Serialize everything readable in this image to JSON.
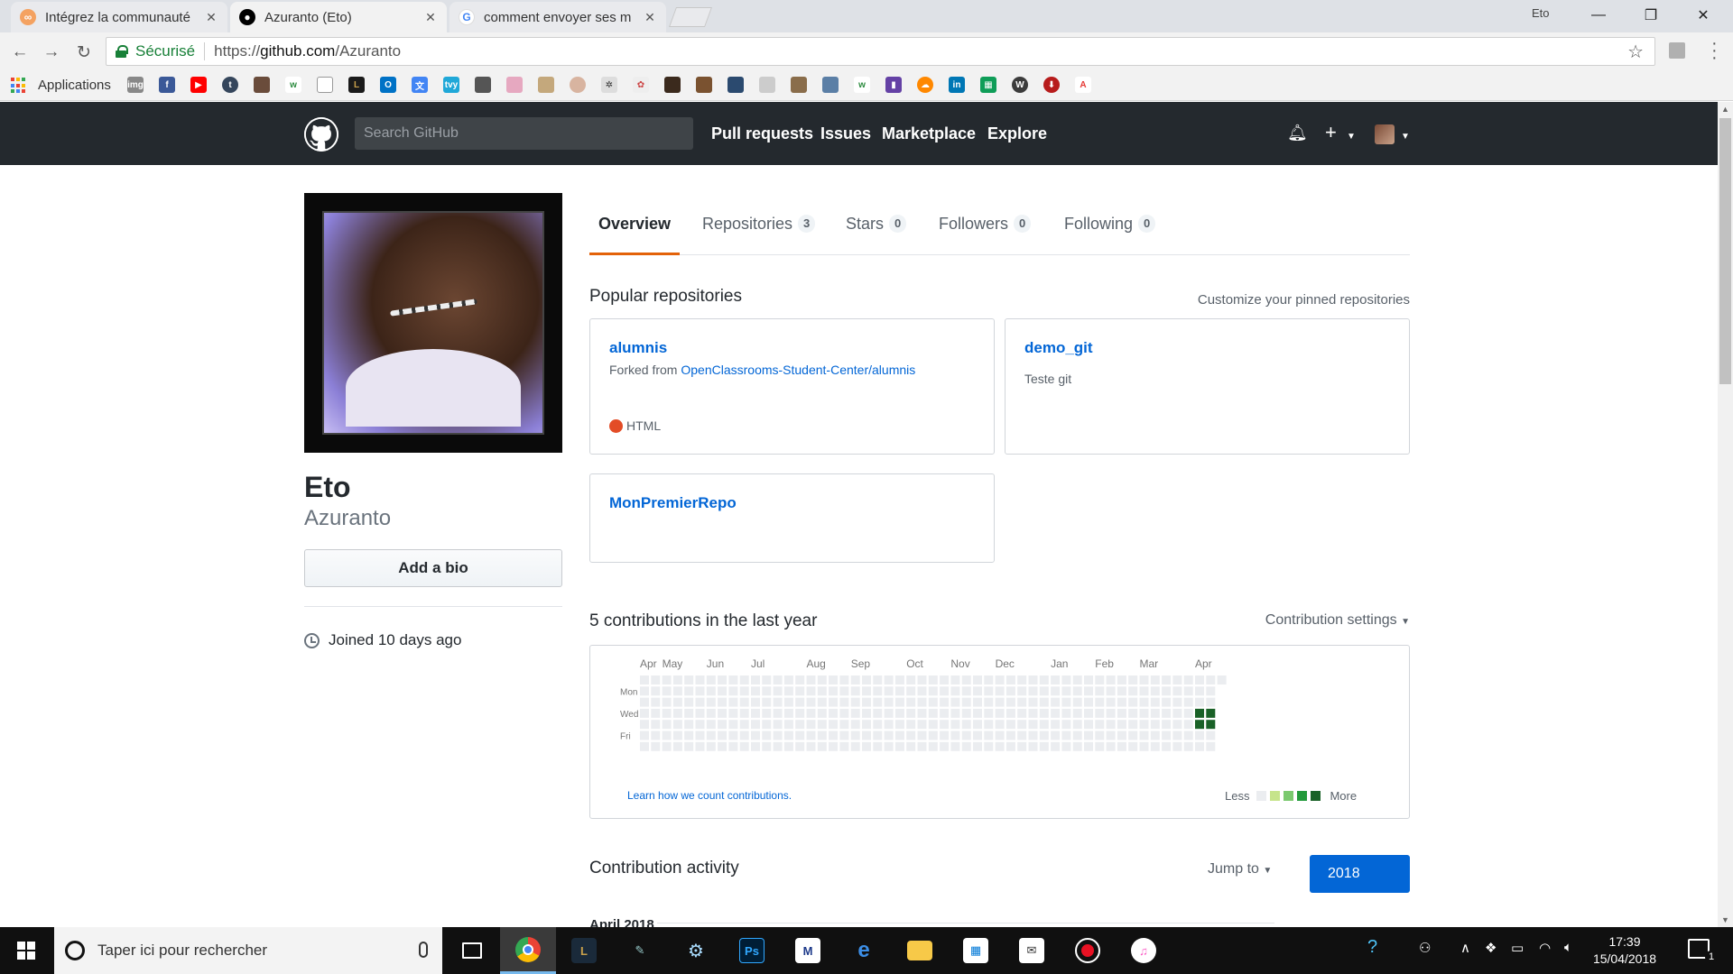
{
  "browser": {
    "tabs": [
      {
        "title": "Intégrez la communauté",
        "favicon": "openclassrooms-icon",
        "active": false
      },
      {
        "title": "Azuranto (Eto)",
        "favicon": "github-icon",
        "active": true
      },
      {
        "title": "comment envoyer ses m",
        "favicon": "google-icon",
        "active": false
      }
    ],
    "user_badge": "Eto",
    "window_buttons": {
      "minimize": "—",
      "restore": "❐",
      "close": "✕"
    },
    "security_label": "Sécurisé",
    "url_scheme": "https://",
    "url_host": "github.com",
    "url_path": "/Azuranto",
    "bookmarks_apps_label": "Applications"
  },
  "github": {
    "search_placeholder": "Search GitHub",
    "nav": [
      "Pull requests",
      "Issues",
      "Marketplace",
      "Explore"
    ],
    "new_label": "+"
  },
  "profile": {
    "full_name": "Eto",
    "login": "Azuranto",
    "add_bio_label": "Add a bio",
    "joined": "Joined 10 days ago"
  },
  "profile_tabs": [
    {
      "label": "Overview",
      "count": null
    },
    {
      "label": "Repositories",
      "count": "3"
    },
    {
      "label": "Stars",
      "count": "0"
    },
    {
      "label": "Followers",
      "count": "0"
    },
    {
      "label": "Following",
      "count": "0"
    }
  ],
  "popular": {
    "title": "Popular repositories",
    "customize": "Customize your pinned repositories",
    "repos": [
      {
        "name": "alumnis",
        "forked_prefix": "Forked from",
        "forked_from": "OpenClassrooms-Student-Center/alumnis",
        "language": "HTML",
        "language_color": "#e34c26"
      },
      {
        "name": "demo_git",
        "description": "Teste git"
      },
      {
        "name": "MonPremierRepo"
      }
    ]
  },
  "contributions": {
    "title": "5 contributions in the last year",
    "settings_label": "Contribution settings",
    "months": [
      "Apr",
      "May",
      "Jun",
      "Jul",
      "Aug",
      "Sep",
      "Oct",
      "Nov",
      "Dec",
      "Jan",
      "Feb",
      "Mar",
      "Apr"
    ],
    "weekdays": [
      "Mon",
      "Wed",
      "Fri"
    ],
    "learn_link": "Learn how we count contributions.",
    "legend_less": "Less",
    "legend_more": "More",
    "colors": [
      "#ebedf0",
      "#c6e48b",
      "#7bc96f",
      "#239a3b",
      "#196127"
    ],
    "chart_data": {
      "type": "heatmap",
      "weeks": 53,
      "days_per_week": 7,
      "last_day": "2018-04-15",
      "x": [
        "Apr",
        "May",
        "Jun",
        "Jul",
        "Aug",
        "Sep",
        "Oct",
        "Nov",
        "Dec",
        "Jan",
        "Feb",
        "Mar",
        "Apr"
      ],
      "y": [
        "Mon",
        "Wed",
        "Fri"
      ],
      "colored_cells": [
        {
          "date": "2018-04-04",
          "level": 4
        },
        {
          "date": "2018-04-05",
          "level": 4
        },
        {
          "date": "2018-04-11",
          "level": 4
        },
        {
          "date": "2018-04-12",
          "level": 4
        }
      ]
    }
  },
  "activity": {
    "title": "Contribution activity",
    "jump_to": "Jump to",
    "year": "2018",
    "month": "April 2018"
  },
  "taskbar": {
    "search_placeholder": "Taper ici pour rechercher",
    "time": "17:39",
    "date": "15/04/2018",
    "notification_count": "1"
  }
}
